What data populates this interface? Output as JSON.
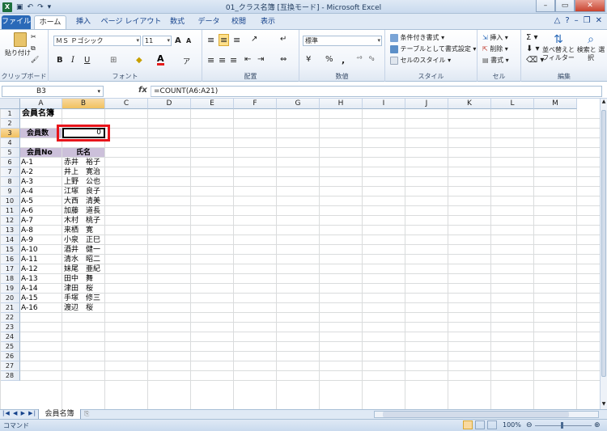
{
  "window": {
    "title": "01_クラス名簿 [互換モード] - Microsoft Excel"
  },
  "tabs": [
    "ファイル",
    "ホーム",
    "挿入",
    "ページ レイアウト",
    "数式",
    "データ",
    "校閲",
    "表示"
  ],
  "ribbon": {
    "clipboard": {
      "label": "クリップボード",
      "paste": "貼り付け"
    },
    "font": {
      "label": "フォント",
      "name": "ＭＳ Ｐゴシック",
      "size": "11",
      "bold": "B",
      "italic": "I",
      "underline": "U",
      "grow": "A",
      "shrink": "A"
    },
    "alignment": {
      "label": "配置"
    },
    "number": {
      "label": "数値",
      "format": "標準",
      "percent": "%",
      "comma": ","
    },
    "styles": {
      "label": "スタイル",
      "conditional": "条件付き書式",
      "table": "テーブルとして書式設定",
      "cell": "セルのスタイル"
    },
    "cells": {
      "label": "セル",
      "insert": "挿入",
      "delete": "削除",
      "format": "書式"
    },
    "editing": {
      "label": "編集",
      "sort": "並べ替えと フィルター",
      "find": "検索と 選択"
    }
  },
  "formula_bar": {
    "name_box": "B3",
    "fx": "fx",
    "formula": "=COUNT(A6:A21)"
  },
  "columns": [
    "A",
    "B",
    "C",
    "D",
    "E",
    "F",
    "G",
    "H",
    "I",
    "J",
    "K",
    "L",
    "M"
  ],
  "rows": [
    "1",
    "2",
    "3",
    "4",
    "5",
    "6",
    "7",
    "8",
    "9",
    "10",
    "11",
    "12",
    "13",
    "14",
    "15",
    "16",
    "17",
    "18",
    "19",
    "20",
    "21",
    "22",
    "23",
    "24",
    "25",
    "26",
    "27",
    "28"
  ],
  "sheet": {
    "title": "会員名簿",
    "count_label": "会員数",
    "count_value": "0",
    "header_no": "会員No",
    "header_name": "氏名",
    "members": [
      {
        "no": "A-1",
        "name": "赤井　裕子"
      },
      {
        "no": "A-2",
        "name": "井上　寛治"
      },
      {
        "no": "A-3",
        "name": "上野　公也"
      },
      {
        "no": "A-4",
        "name": "江塚　良子"
      },
      {
        "no": "A-5",
        "name": "大西　清美"
      },
      {
        "no": "A-6",
        "name": "加藤　道長"
      },
      {
        "no": "A-7",
        "name": "木村　桃子"
      },
      {
        "no": "A-8",
        "name": "来栖　寛"
      },
      {
        "no": "A-9",
        "name": "小泉　正巳"
      },
      {
        "no": "A-10",
        "name": "酒井　健一"
      },
      {
        "no": "A-11",
        "name": "清水　昭二"
      },
      {
        "no": "A-12",
        "name": "妹尾　亜紀"
      },
      {
        "no": "A-13",
        "name": "田中　舞"
      },
      {
        "no": "A-14",
        "name": "津田　桜"
      },
      {
        "no": "A-15",
        "name": "手塚　修三"
      },
      {
        "no": "A-16",
        "name": "渡辺　桜"
      }
    ]
  },
  "sheet_tab": "会員名簿",
  "status": {
    "mode": "コマンド",
    "zoom": "100%"
  },
  "colors": {
    "accent_header": "#ccc0da",
    "highlight": "#e8141b",
    "file_tab": "#2a69b8"
  }
}
